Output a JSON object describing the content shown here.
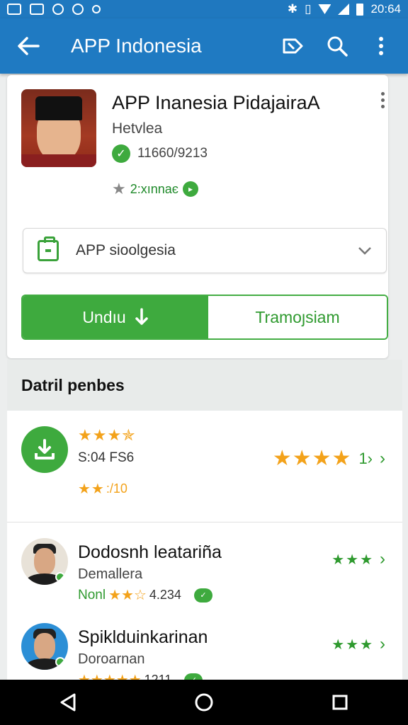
{
  "status_bar": {
    "time": "20:64",
    "icons": [
      "gallery-icon",
      "image-icon",
      "shield-icon",
      "settings-icon",
      "dot-icon",
      "bluetooth-icon",
      "vibrate-icon",
      "wifi-icon",
      "signal-icon",
      "battery-icon"
    ]
  },
  "app_bar": {
    "title": "APP Indonesia",
    "actions": [
      "tag-icon",
      "search-icon",
      "more-vert-icon"
    ]
  },
  "app_card": {
    "name": "APP Inanesia PidajairaA",
    "developer": "Hetvlea",
    "verified_text": "11660/9213",
    "rating_text": "2:хınnaє",
    "dropdown": {
      "label": "APP sioolgesia"
    },
    "buttons": {
      "primary": "Undıu",
      "secondary": "Tramoȷsiam"
    }
  },
  "section": {
    "title": "Datril penbes"
  },
  "download_row": {
    "subtitle": "S:04 FS6",
    "rating_value": ":/10",
    "count": "1›"
  },
  "people": [
    {
      "name": "Dodosnh leatariña",
      "subtitle": "Demallera",
      "label": "Nonl",
      "stat": "4.234"
    },
    {
      "name": "Spiklduinkarinan",
      "subtitle": "Doroarnan",
      "label": "",
      "stat": "1211"
    }
  ],
  "colors": {
    "primary_blue": "#1f7ac2",
    "accent_green": "#3eaa3e",
    "star_yellow": "#f3a21a"
  }
}
